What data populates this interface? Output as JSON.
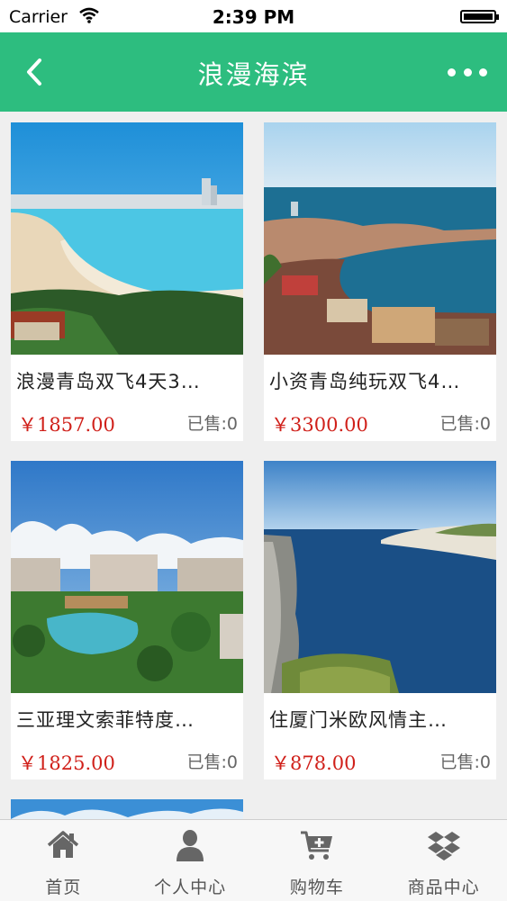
{
  "status_bar": {
    "carrier": "Carrier",
    "time": "2:39 PM"
  },
  "nav": {
    "title": "浪漫海滨",
    "back_icon": "chevron-left-icon",
    "more_icon": "more-dots-icon"
  },
  "products": [
    {
      "name": "浪漫青岛双飞4天3…",
      "price": "￥1857.00",
      "sold": "已售:0",
      "image": "qingdao-beach-photo"
    },
    {
      "name": "小资青岛纯玩双飞4…",
      "price": "￥3300.00",
      "sold": "已售:0",
      "image": "qingdao-coast-city-photo"
    },
    {
      "name": "三亚理文索菲特度…",
      "price": "￥1825.00",
      "sold": "已售:0",
      "image": "sanya-resort-photo"
    },
    {
      "name": "住厦门米欧风情主…",
      "price": "￥878.00",
      "sold": "已售:0",
      "image": "sea-cliff-photo"
    }
  ],
  "tabbar": {
    "items": [
      {
        "label": "首页",
        "icon": "home-icon"
      },
      {
        "label": "个人中心",
        "icon": "user-icon"
      },
      {
        "label": "购物车",
        "icon": "cart-icon"
      },
      {
        "label": "商品中心",
        "icon": "dropbox-icon"
      }
    ]
  }
}
